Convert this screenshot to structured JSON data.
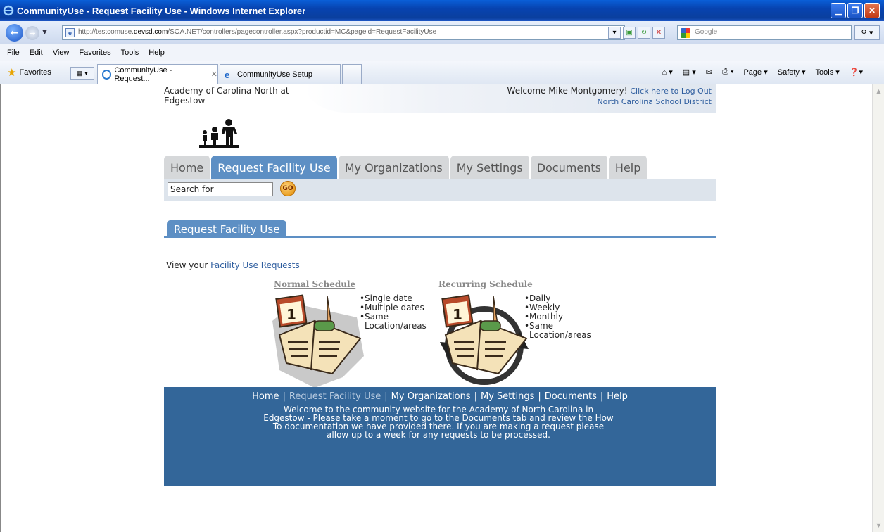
{
  "window": {
    "title": "CommunityUse - Request Facility Use - Windows Internet Explorer"
  },
  "address": {
    "url_prefix": "http://testcomuse.",
    "url_domain": "devsd.com",
    "url_suffix": "/SOA.NET/controllers/pagecontroller.aspx?productid=MC&pageid=RequestFacilityUse",
    "search_placeholder": "Google"
  },
  "menu": [
    "File",
    "Edit",
    "View",
    "Favorites",
    "Tools",
    "Help"
  ],
  "favorites": {
    "label": "Favorites",
    "tabs": [
      {
        "label": "CommunityUse - Request...",
        "active": true
      },
      {
        "label": "CommunityUse Setup",
        "active": false
      }
    ],
    "tools": [
      "Page ▾",
      "Safety ▾",
      "Tools ▾"
    ]
  },
  "site": {
    "org_name": "Academy of Carolina North at Edgestow",
    "welcome": "Welcome Mike Montgomery!",
    "logout": "Click here to Log Out",
    "district": "North Carolina School District",
    "nav": [
      "Home",
      "Request Facility Use",
      "My Organizations",
      "My Settings",
      "Documents",
      "Help"
    ],
    "active_nav": 1,
    "search_value": "Search for",
    "go_label": "GO",
    "section_title": "Request Facility Use",
    "view_prefix": "View your",
    "view_link": "Facility Use Requests",
    "normal": {
      "title": "Normal Schedule",
      "items": [
        "Single date",
        "Multiple dates",
        "Same",
        "Location/areas"
      ]
    },
    "recurring": {
      "title": "Recurring Schedule",
      "items": [
        "Daily",
        "Weekly",
        "Monthly",
        "Same",
        "Location/areas"
      ]
    },
    "footer_nav": [
      "Home",
      "Request Facility Use",
      "My Organizations",
      "My Settings",
      "Documents",
      "Help"
    ],
    "footer_text": "Welcome to the community website for the Academy of North Carolina in Edgestow - Please take a moment to go to the Documents tab and review the How To documentation we have provided there. If you are making a request please allow up to a week for any requests to be processed."
  },
  "colors": {
    "tab_active": "#5d8fc4",
    "footer_bg": "#336699",
    "link": "#2f5e9f"
  }
}
